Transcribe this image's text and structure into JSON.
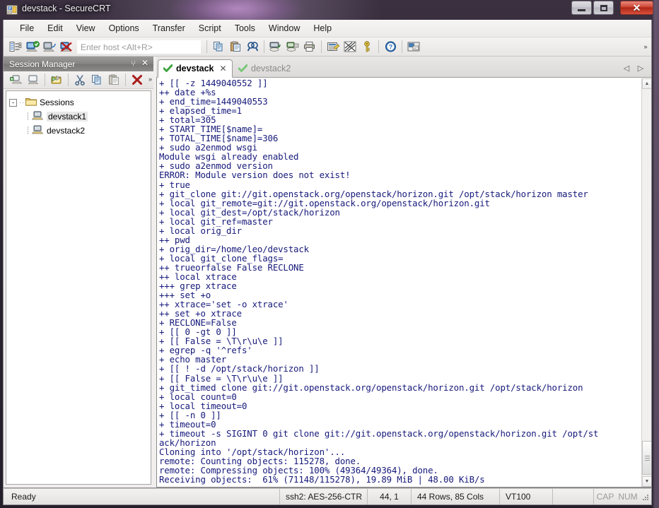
{
  "window": {
    "title": "devstack - SecureCRT",
    "icon": "securecrt-app-icon",
    "buttons": {
      "minimize": "minimize",
      "maximize": "maximize",
      "close": "close"
    }
  },
  "menubar": {
    "items": [
      {
        "label": "File"
      },
      {
        "label": "Edit"
      },
      {
        "label": "View"
      },
      {
        "label": "Options"
      },
      {
        "label": "Transfer"
      },
      {
        "label": "Script"
      },
      {
        "label": "Tools"
      },
      {
        "label": "Window"
      },
      {
        "label": "Help"
      }
    ]
  },
  "toolbar": {
    "host_entry_placeholder": "Enter host <Alt+R>",
    "host_entry_value": "",
    "buttons": [
      {
        "name": "session-manager-icon"
      },
      {
        "name": "connect-icon"
      },
      {
        "name": "connect-in-tab-icon"
      },
      {
        "name": "disconnect-icon"
      },
      {
        "name": "copy-icon"
      },
      {
        "name": "paste-icon"
      },
      {
        "name": "find-icon"
      },
      {
        "name": "log-session-icon"
      },
      {
        "name": "print-screen-icon"
      },
      {
        "name": "print-icon"
      },
      {
        "name": "session-options-icon"
      },
      {
        "name": "global-options-icon"
      },
      {
        "name": "key-icon"
      },
      {
        "name": "help-icon"
      },
      {
        "name": "arrange-windows-icon"
      }
    ],
    "overflow_label": "»"
  },
  "session_manager": {
    "title": "Session Manager",
    "pin_label": "⑂",
    "close_label": "✕",
    "toolbar_buttons": [
      {
        "name": "new-session-icon"
      },
      {
        "name": "new-folder-icon"
      },
      {
        "name": "import-export-icon"
      },
      {
        "name": "cut-icon"
      },
      {
        "name": "copy-icon"
      },
      {
        "name": "paste-icon"
      },
      {
        "name": "delete-icon"
      }
    ],
    "overflow_label": "»",
    "tree": {
      "root": {
        "label": "Sessions",
        "expander": "-"
      },
      "children": [
        {
          "label": "devstack1",
          "selected": true
        },
        {
          "label": "devstack2",
          "selected": false
        }
      ]
    }
  },
  "tabs": {
    "items": [
      {
        "label": "devstack",
        "active": true,
        "close_label": "✕"
      },
      {
        "label": "devstack2",
        "active": false
      }
    ],
    "scroll_left": "◁",
    "scroll_right": "▷"
  },
  "terminal": {
    "text_color": "#16197a",
    "background": "#ffffff",
    "lines": [
      "+ [[ -z 1449040552 ]]",
      "++ date +%s",
      "+ end_time=1449040553",
      "+ elapsed_time=1",
      "+ total=305",
      "+ START_TIME[$name]=",
      "+ TOTAL_TIME[$name]=306",
      "+ sudo a2enmod wsgi",
      "Module wsgi already enabled",
      "+ sudo a2enmod version",
      "ERROR: Module version does not exist!",
      "+ true",
      "+ git_clone git://git.openstack.org/openstack/horizon.git /opt/stack/horizon master",
      "+ local git_remote=git://git.openstack.org/openstack/horizon.git",
      "+ local git_dest=/opt/stack/horizon",
      "+ local git_ref=master",
      "+ local orig_dir",
      "++ pwd",
      "+ orig_dir=/home/leo/devstack",
      "+ local git_clone_flags=",
      "++ trueorfalse False RECLONE",
      "++ local xtrace",
      "+++ grep xtrace",
      "+++ set +o",
      "++ xtrace='set -o xtrace'",
      "++ set +o xtrace",
      "+ RECLONE=False",
      "+ [[ 0 -gt 0 ]]",
      "+ [[ False = \\T\\r\\u\\e ]]",
      "+ egrep -q '^refs'",
      "+ echo master",
      "+ [[ ! -d /opt/stack/horizon ]]",
      "+ [[ False = \\T\\r\\u\\e ]]",
      "+ git_timed clone git://git.openstack.org/openstack/horizon.git /opt/stack/horizon",
      "+ local count=0",
      "+ local timeout=0",
      "+ [[ -n 0 ]]",
      "+ timeout=0",
      "+ timeout -s SIGINT 0 git clone git://git.openstack.org/openstack/horizon.git /opt/st",
      "ack/horizon",
      "Cloning into '/opt/stack/horizon'...",
      "remote: Counting objects: 115278, done.",
      "remote: Compressing objects: 100% (49364/49364), done.",
      "Receiving objects:  61% (71148/115278), 19.89 MiB | 48.00 KiB/s"
    ],
    "scrollbar": {
      "up": "▲",
      "down": "▼"
    }
  },
  "statusbar": {
    "status": "Ready",
    "cipher": "ssh2: AES-256-CTR",
    "position": "44,  1",
    "dimensions": "44 Rows, 85 Cols",
    "emulation": "VT100",
    "caps_indicator": "CAP",
    "num_indicator": "NUM"
  }
}
